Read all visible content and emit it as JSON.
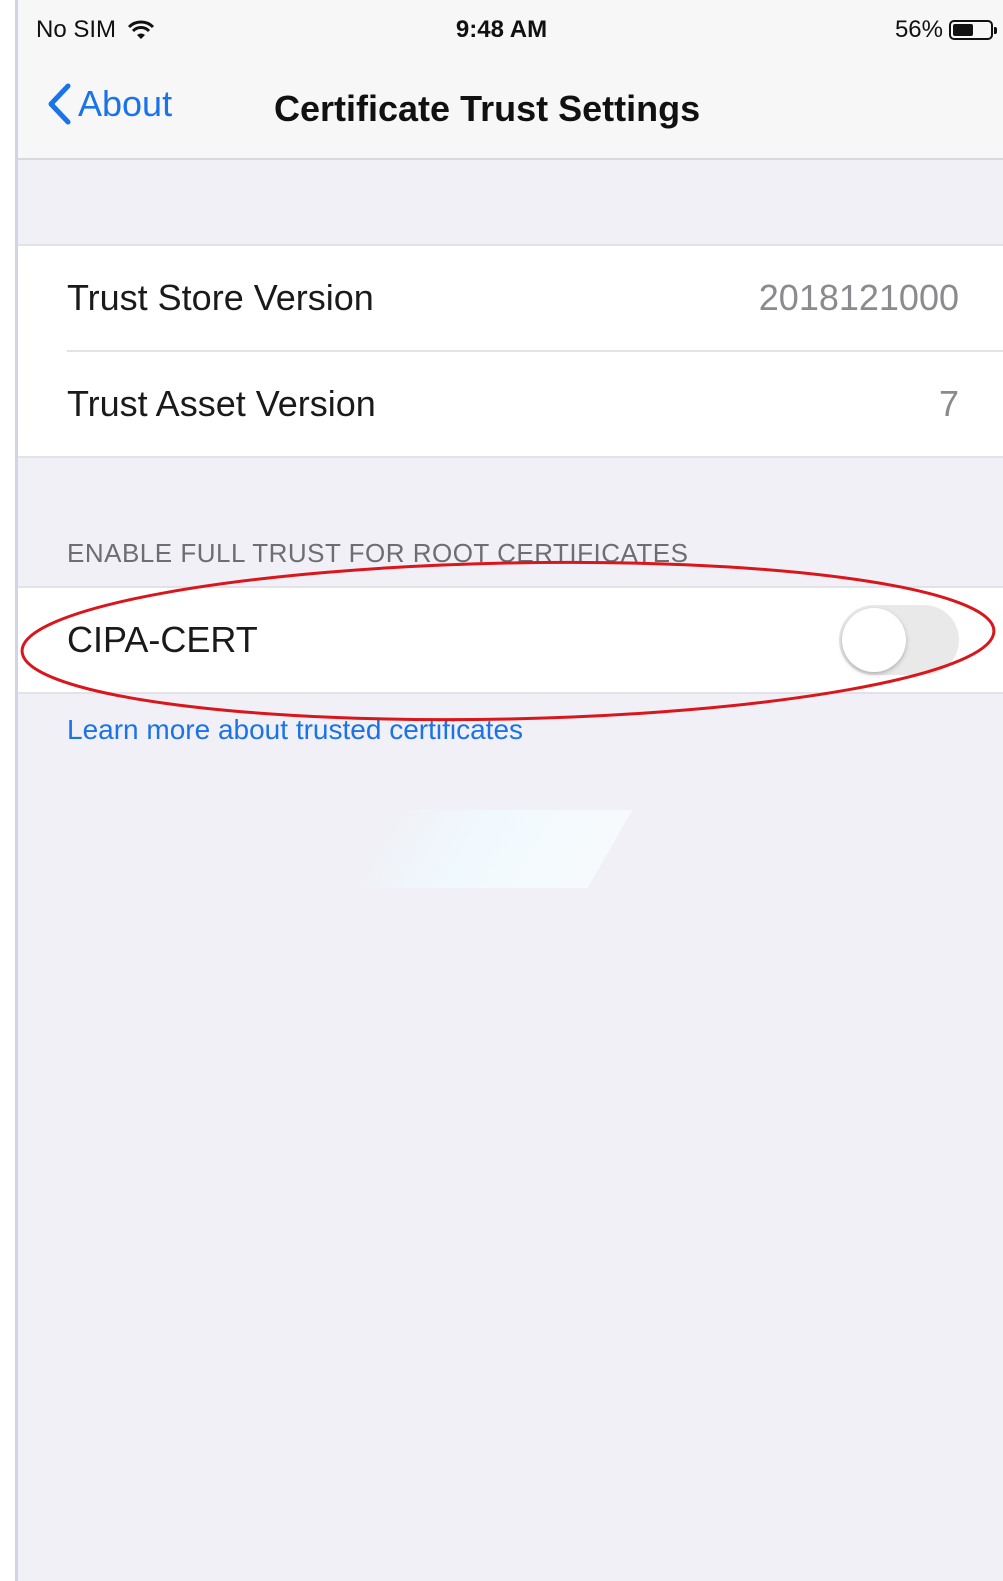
{
  "status_bar": {
    "carrier": "No SIM",
    "time": "9:48 AM",
    "battery_percent": "56%",
    "battery_level": 0.56,
    "wifi_icon": "wifi-icon",
    "battery_icon": "battery-icon"
  },
  "nav": {
    "back_label": "About",
    "back_icon": "chevron-left-icon",
    "title": "Certificate Trust Settings"
  },
  "versions": {
    "rows": [
      {
        "label": "Trust Store Version",
        "value": "2018121000"
      },
      {
        "label": "Trust Asset Version",
        "value": "7"
      }
    ]
  },
  "trust_section": {
    "header": "ENABLE FULL TRUST FOR ROOT CERTIFICATES",
    "certificates": [
      {
        "name": "CIPA-CERT",
        "enabled": false
      }
    ],
    "footer_link": "Learn more about trusted certificates"
  },
  "colors": {
    "accent": "#1a73e8",
    "annotation": "#d9161c",
    "background": "#f0f0f6"
  }
}
